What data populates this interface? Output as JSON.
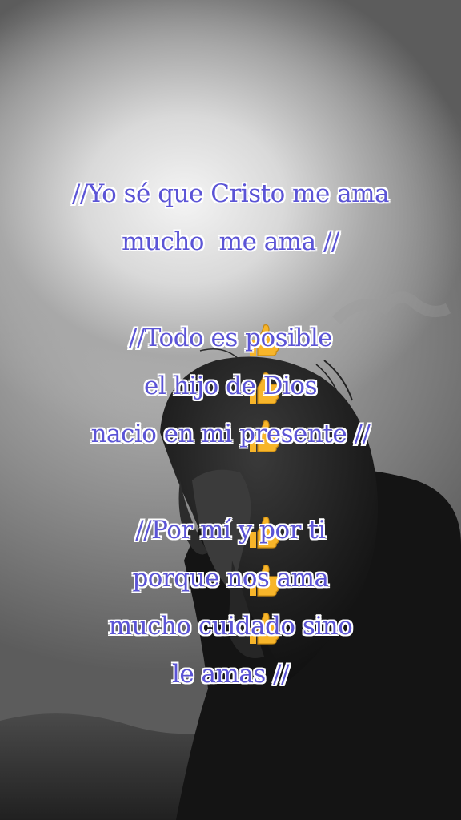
{
  "lyrics": {
    "line1": "//Yo sé que Cristo me ama",
    "line2": "mucho  me ama //",
    "emoji_row_1": "👍👍👍",
    "line3": "//Todo es posible",
    "line4": "el hijo de Dios",
    "line5": "nacio en mi presente //",
    "emoji_row_2": "👍👍👍",
    "line6": "//Por mí y por ti",
    "line7": "porque nos ama",
    "line8": "mucho cuidado sino",
    "line9": "le amas //"
  },
  "colors": {
    "text": "#5b54d6",
    "text_outline": "#ffffff",
    "thumb": "#f7b52a"
  },
  "icons": {
    "emoji": "thumbs-up-icon"
  }
}
